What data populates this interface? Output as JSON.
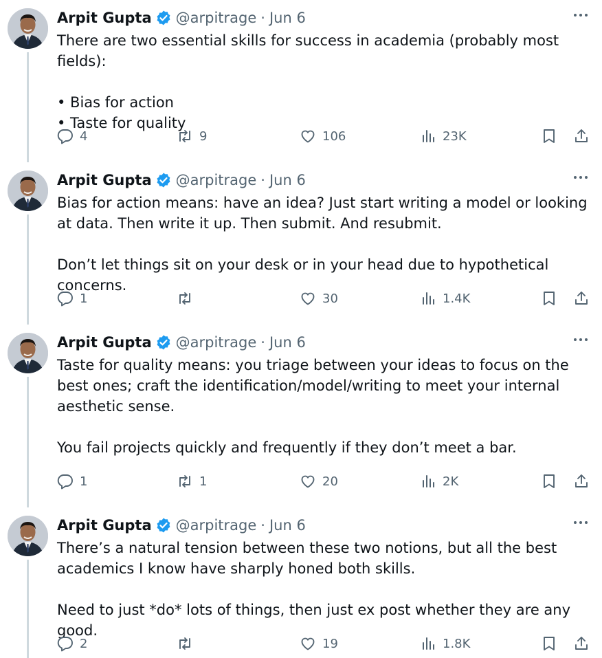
{
  "tweets": [
    {
      "author": "Arpit Gupta",
      "handle": "@arpitrage",
      "separator": "·",
      "date": "Jun 6",
      "text": "There are two essential skills for success in academia (probably most fields):\n\n• Bias for action\n• Taste for quality",
      "replies": "4",
      "retweets": "9",
      "likes": "106",
      "views": "23K"
    },
    {
      "author": "Arpit Gupta",
      "handle": "@arpitrage",
      "separator": "·",
      "date": "Jun 6",
      "text": "Bias for action means: have an idea? Just start writing a model or looking at data. Then write it up. Then submit. And resubmit.\n\nDon’t let things sit on your desk or in your head due to hypothetical concerns.",
      "replies": "1",
      "retweets": "",
      "likes": "30",
      "views": "1.4K"
    },
    {
      "author": "Arpit Gupta",
      "handle": "@arpitrage",
      "separator": "·",
      "date": "Jun 6",
      "text": "Taste for quality means: you triage between your ideas to focus on the best ones; craft the identification/model/writing to meet your internal aesthetic sense.\n\nYou fail projects quickly and frequently if they don’t meet a bar.",
      "replies": "1",
      "retweets": "1",
      "likes": "20",
      "views": "2K"
    },
    {
      "author": "Arpit Gupta",
      "handle": "@arpitrage",
      "separator": "·",
      "date": "Jun 6",
      "text": "There’s a natural tension between these two notions, but all the best academics I know have sharply honed both skills.\n\nNeed to just *do* lots of things, then just ex post whether they are any good.",
      "replies": "2",
      "retweets": "",
      "likes": "19",
      "views": "1.8K"
    }
  ],
  "colors": {
    "text": "#0f1419",
    "muted": "#536471",
    "verified": "#1d9bf0",
    "thread_line": "#cfd9de"
  },
  "icons": [
    "reply-icon",
    "retweet-icon",
    "like-icon",
    "views-icon",
    "bookmark-icon",
    "share-icon",
    "more-icon",
    "verified-icon"
  ]
}
